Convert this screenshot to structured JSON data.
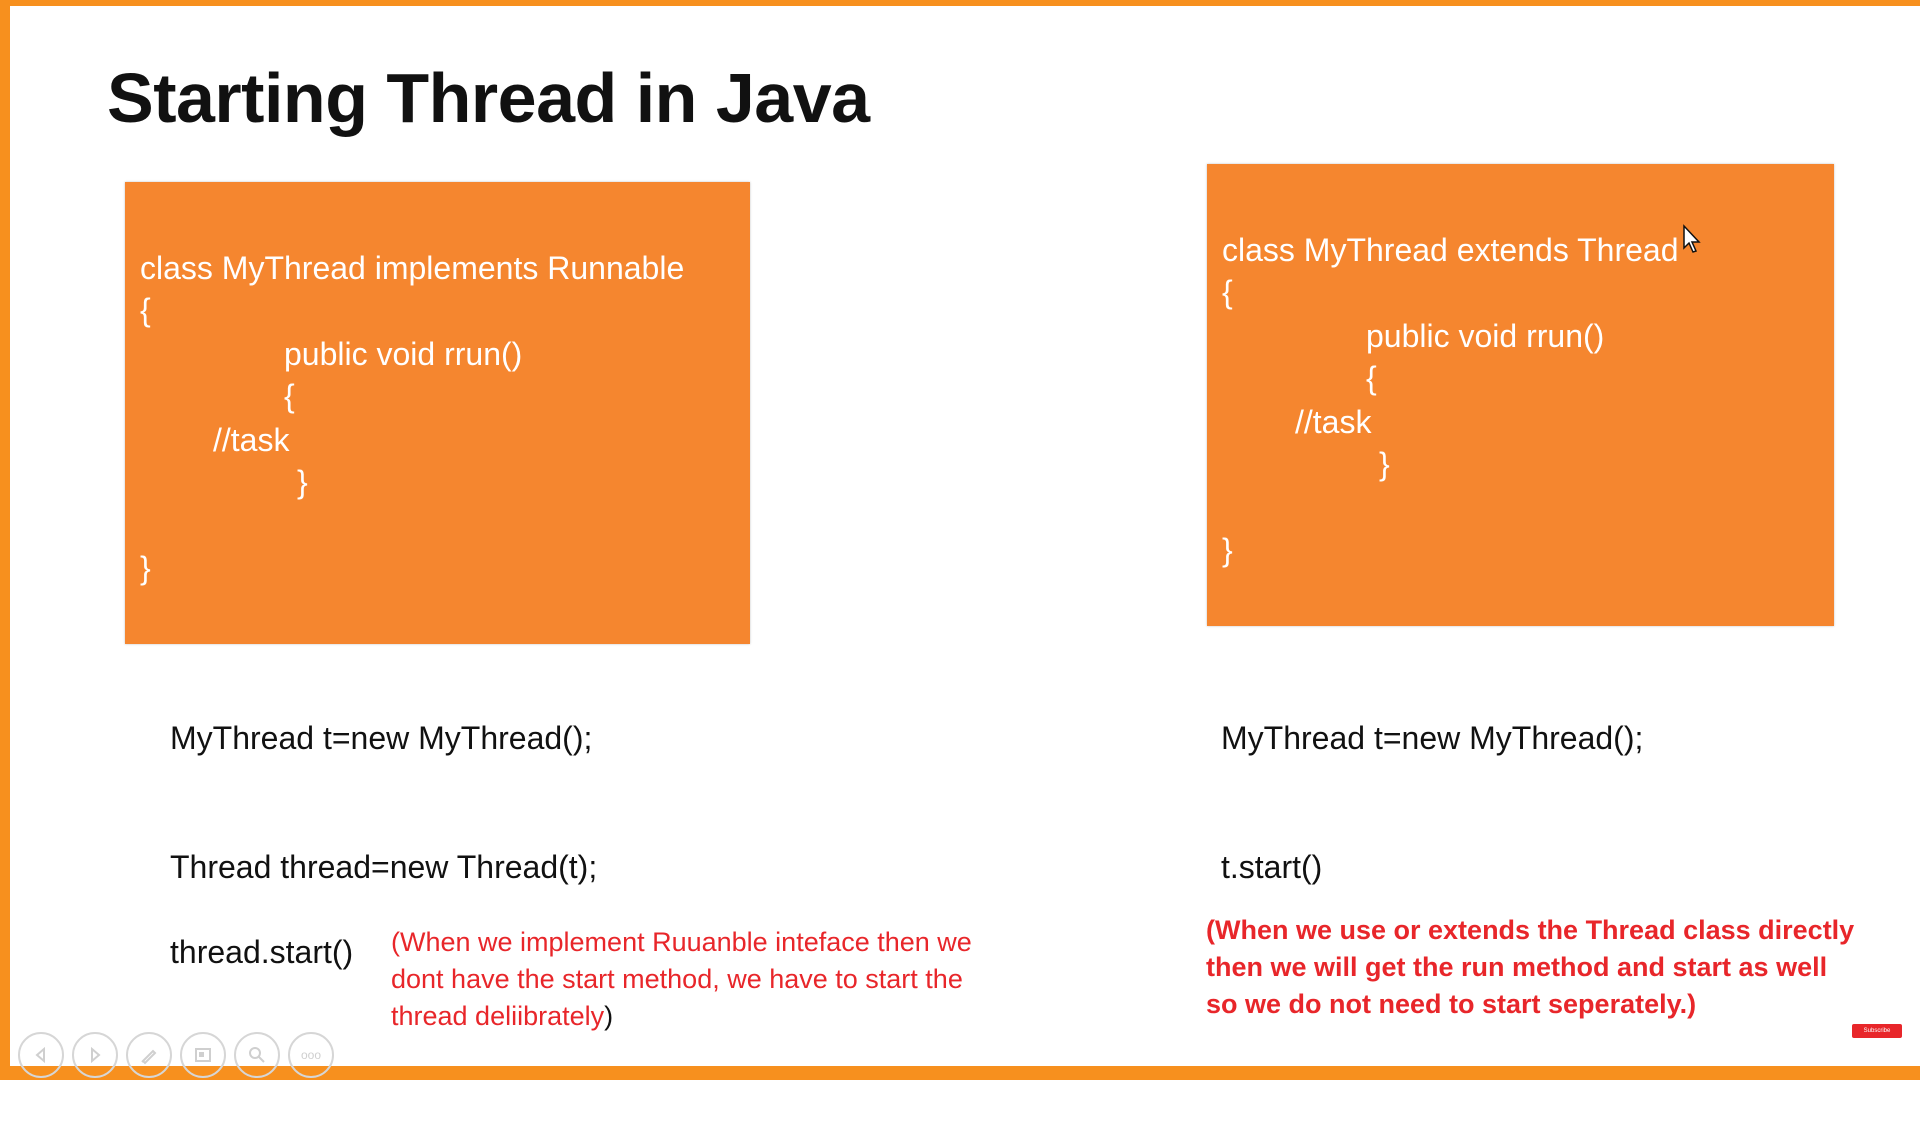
{
  "slide": {
    "title": "Starting Thread in Java",
    "left": {
      "box_lines": [
        "class MyThread implements Runnable",
        "{",
        "public void rrun()",
        "{",
        "//task",
        "}",
        "}"
      ],
      "line1": "MyThread t=new MyThread();",
      "line2": "Thread thread=new Thread(t);",
      "line3": "thread.start()",
      "note": "(When we implement Ruuanble inteface then we dont have the start method, we have to start the thread  deliibrately",
      "note_close": ")"
    },
    "right": {
      "box_lines": [
        "class MyThread extends Thread",
        "{",
        "public void rrun()",
        "{",
        "//task",
        "}",
        "}"
      ],
      "line1": "MyThread t=new MyThread();",
      "line2": "t.start()",
      "note": "(When we use or extends the Thread class directly then we will get the run method and start as well so we do not need to start seperately.)"
    }
  },
  "controls": {
    "icons": [
      "previous-icon",
      "next-icon",
      "pen-icon",
      "slides-icon",
      "zoom-icon",
      "more-icon"
    ],
    "more_label": "ooo"
  },
  "badge": {
    "subscribe_label": "Subscribe"
  },
  "colors": {
    "accent": "#f7901e",
    "box": "#f5862f",
    "note": "#e8262a"
  }
}
